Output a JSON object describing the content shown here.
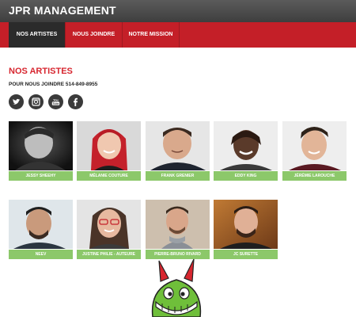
{
  "header": {
    "brand": "JPR MANAGEMENT"
  },
  "nav": {
    "items": [
      "NOS ARTISTES",
      "NOUS JOINDRE",
      "NOTRE MISSION"
    ]
  },
  "main": {
    "title": "NOS ARTISTES",
    "contact": "POUR NOUS JOINDRE 514-849-8955",
    "social": [
      "twitter-icon",
      "instagram-icon",
      "youtube-icon",
      "facebook-icon"
    ],
    "artists": [
      "JESSY SHEEHY",
      "MÉLANIE COUTURE",
      "FRANK GRENIER",
      "EDDY KING",
      "JÉRÉMIE LAROUCHE",
      "NEEV",
      "JUSTINE PHILIE - AUTEURE",
      "PIERRE-BRUNO RIVARD",
      "JC SURETTE"
    ]
  },
  "colors": {
    "brand_red": "#c41f28",
    "title_red": "#d7262f",
    "label_green": "#8cc86a",
    "nav_active": "#2b2b2b"
  }
}
